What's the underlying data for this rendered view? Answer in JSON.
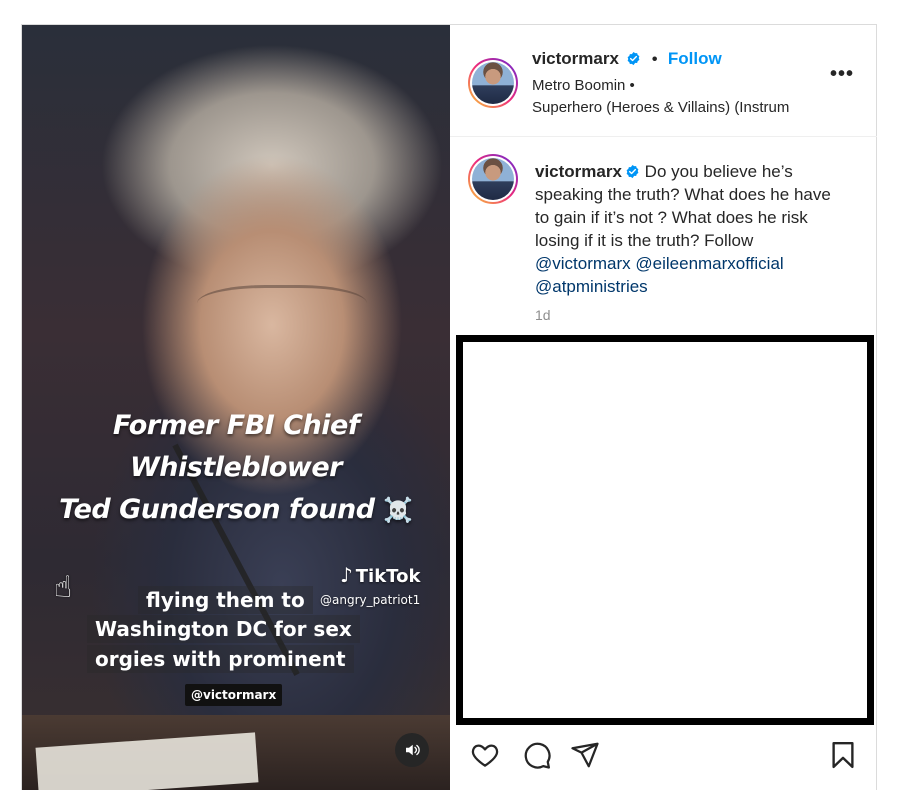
{
  "video": {
    "headline": [
      "Former FBI Chief",
      "Whistleblower",
      "Ted Gunderson found"
    ],
    "headline_emoji": "☠️",
    "tiktok_logo_text": "TikTok",
    "tiktok_handle": "@angry_patriot1",
    "caption": [
      "flying them to",
      "Washington DC for sex",
      "orgies with prominent"
    ],
    "watermark": "@victormarx",
    "sound_icon": "speaker-icon"
  },
  "header": {
    "username": "victormarx",
    "verified": true,
    "separator": "•",
    "follow_label": "Follow",
    "audio_artist": "Metro Boomin •",
    "audio_track": "Superhero (Heroes & Villains) (Instrum",
    "more_label": "•••"
  },
  "caption": {
    "username": "victormarx",
    "text": " Do you believe he’s speaking the truth? What does he have to gain if it’s not ? What does he risk losing if it is the truth? Follow ",
    "mentions": [
      "@victormarx",
      "@eileenmarxofficial",
      "@atpministries"
    ],
    "timestamp": "1d"
  },
  "actions": {
    "like_icon": "heart-icon",
    "comment_icon": "comment-icon",
    "share_icon": "paper-plane-icon",
    "save_icon": "bookmark-icon"
  },
  "colors": {
    "link_blue": "#0095f6",
    "mention_blue": "#00376b",
    "verified_blue": "#0095f6",
    "muted_gray": "#8e8e8e"
  }
}
